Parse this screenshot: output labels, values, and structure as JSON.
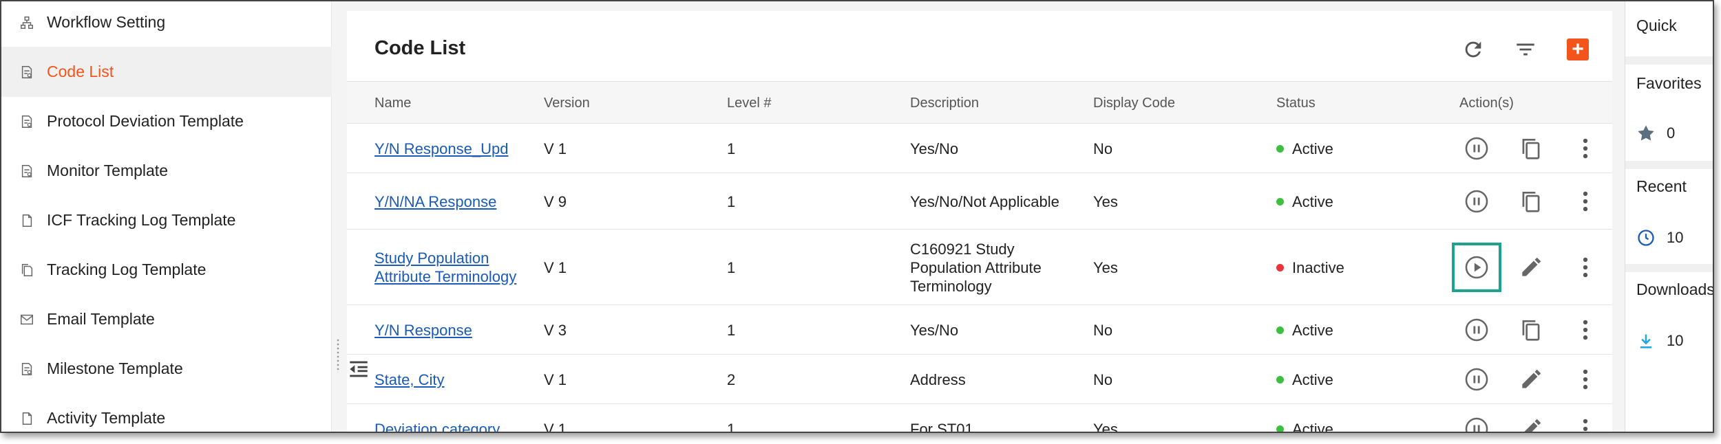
{
  "sidebar": {
    "items": [
      {
        "label": "Workflow Setting",
        "icon": "sitemap-icon",
        "active": false
      },
      {
        "label": "Code List",
        "icon": "code-list-icon",
        "active": true
      },
      {
        "label": "Protocol Deviation Template",
        "icon": "template-icon",
        "active": false
      },
      {
        "label": "Monitor Template",
        "icon": "template-icon",
        "active": false
      },
      {
        "label": "ICF Tracking Log Template",
        "icon": "document-icon",
        "active": false
      },
      {
        "label": "Tracking Log Template",
        "icon": "copy-document-icon",
        "active": false
      },
      {
        "label": "Email Template",
        "icon": "mail-icon",
        "active": false
      },
      {
        "label": "Milestone Template",
        "icon": "template-icon",
        "active": false
      },
      {
        "label": "Activity Template",
        "icon": "document-icon",
        "active": false
      }
    ]
  },
  "main": {
    "title": "Code List",
    "columns": [
      "Name",
      "Version",
      "Level #",
      "Description",
      "Display Code",
      "Status",
      "Action(s)"
    ],
    "rows": [
      {
        "name": "Y/N Response_Upd",
        "version": "V 1",
        "level": "1",
        "description": "Yes/No",
        "display_code": "No",
        "status": "Active",
        "toggle": "pause",
        "second": "copy"
      },
      {
        "name": "Y/N/NA Response",
        "version": "V 9",
        "level": "1",
        "description": "Yes/No/Not Applicable",
        "display_code": "Yes",
        "status": "Active",
        "toggle": "pause",
        "second": "copy"
      },
      {
        "name": "Study Population Attribute Terminology",
        "version": "V 1",
        "level": "1",
        "description": "C160921 Study Population Attribute Terminology",
        "display_code": "Yes",
        "status": "Inactive",
        "toggle": "play",
        "second": "edit"
      },
      {
        "name": "Y/N Response",
        "version": "V 3",
        "level": "1",
        "description": "Yes/No",
        "display_code": "No",
        "status": "Active",
        "toggle": "pause",
        "second": "copy"
      },
      {
        "name": "State, City",
        "version": "V 1",
        "level": "2",
        "description": "Address",
        "display_code": "No",
        "status": "Active",
        "toggle": "pause",
        "second": "edit"
      },
      {
        "name": "Deviation category",
        "version": "V 1",
        "level": "1",
        "description": "For ST01",
        "display_code": "Yes",
        "status": "Active",
        "toggle": "pause",
        "second": "edit"
      }
    ]
  },
  "quick": {
    "title": "Quick",
    "favorites_label": "Favorites",
    "favorites_count": "0",
    "recent_label": "Recent",
    "recent_count": "10",
    "downloads_label": "Downloads",
    "downloads_count": "10"
  },
  "colors": {
    "accent": "#f2541b",
    "active_status": "#3fbf3f",
    "inactive_status": "#e8343a",
    "link": "#1a5ab8",
    "highlight": "#1aa38e"
  }
}
